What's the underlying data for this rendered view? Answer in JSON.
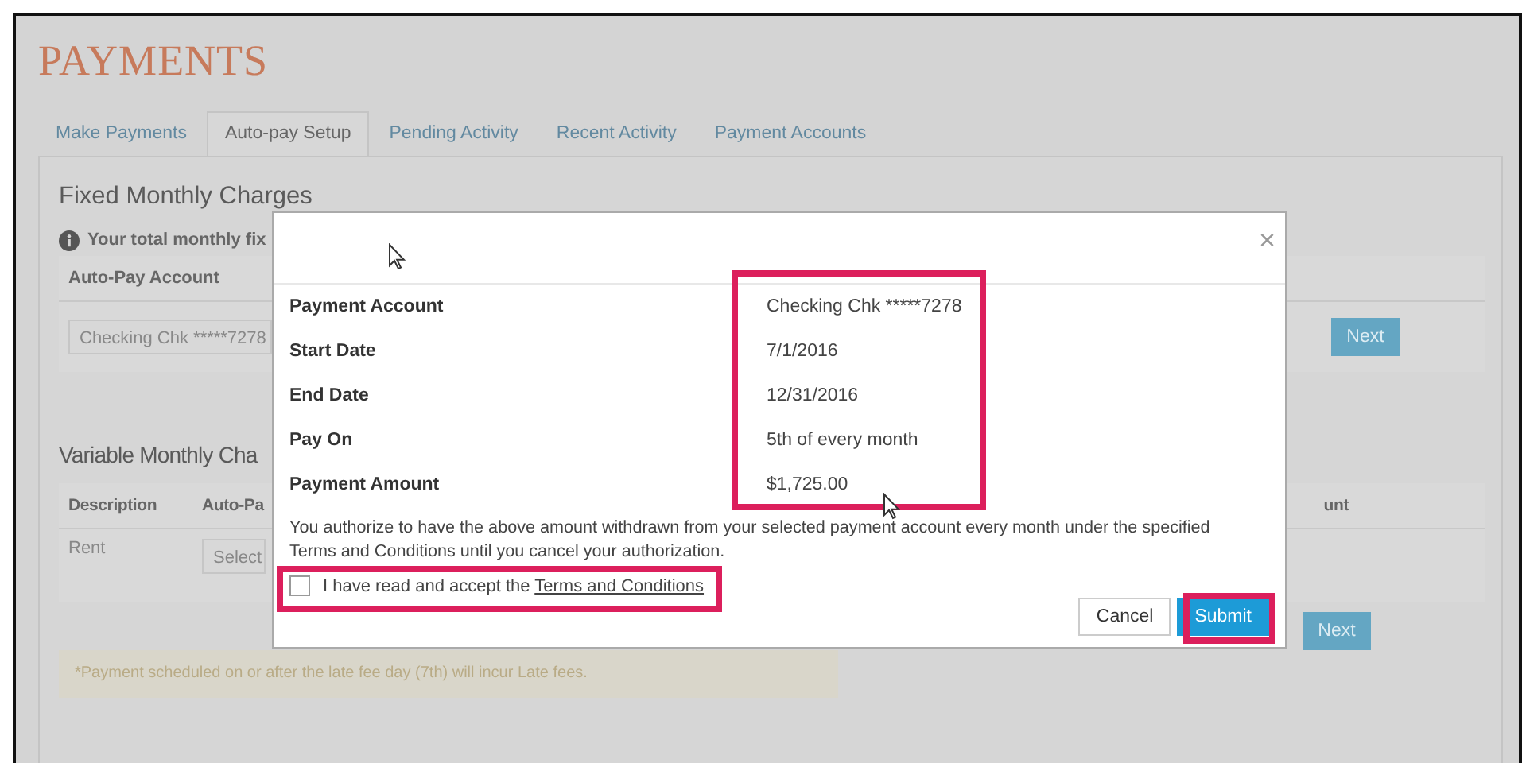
{
  "page_title": "PAYMENTS",
  "tabs": [
    {
      "label": "Make Payments",
      "selected": false
    },
    {
      "label": "Auto-pay Setup",
      "selected": true
    },
    {
      "label": "Pending Activity",
      "selected": false
    },
    {
      "label": "Recent Activity",
      "selected": false
    },
    {
      "label": "Payment Accounts",
      "selected": false
    }
  ],
  "fixed_section": {
    "title": "Fixed Monthly Charges",
    "info": "Your total monthly fix",
    "column_header": "Auto-Pay Account",
    "account_field": {
      "value": "Checking Chk *****7278"
    },
    "next_button": "Next"
  },
  "variable_section": {
    "title": "Variable Monthly Cha",
    "columns": [
      "Description",
      "Auto-Pa",
      "unt"
    ],
    "rows": [
      {
        "description": "Rent",
        "account_field": {
          "value": "Select"
        }
      }
    ],
    "next_button": "Next"
  },
  "note": "*Payment scheduled on or after the late fee day (7th) will incur Late fees.",
  "dialog": {
    "close": "×",
    "rows": [
      {
        "label": "Payment Account",
        "value": "Checking Chk *****7278"
      },
      {
        "label": "Start Date",
        "value": "7/1/2016"
      },
      {
        "label": "End Date",
        "value": "12/31/2016"
      },
      {
        "label": "Pay On",
        "value": "5th of every month"
      },
      {
        "label": "Payment Amount",
        "value": "$1,725.00"
      }
    ],
    "authorization": "You authorize to have the above amount withdrawn from your selected payment account every month under the specified Terms and Conditions until you cancel your authorization.",
    "accept": {
      "checked": false,
      "text": "I have read and accept the",
      "link": "Terms and Conditions"
    },
    "buttons": [
      {
        "label": "Cancel",
        "kind": "secondary"
      },
      {
        "label": "Submit",
        "kind": "primary"
      }
    ]
  }
}
